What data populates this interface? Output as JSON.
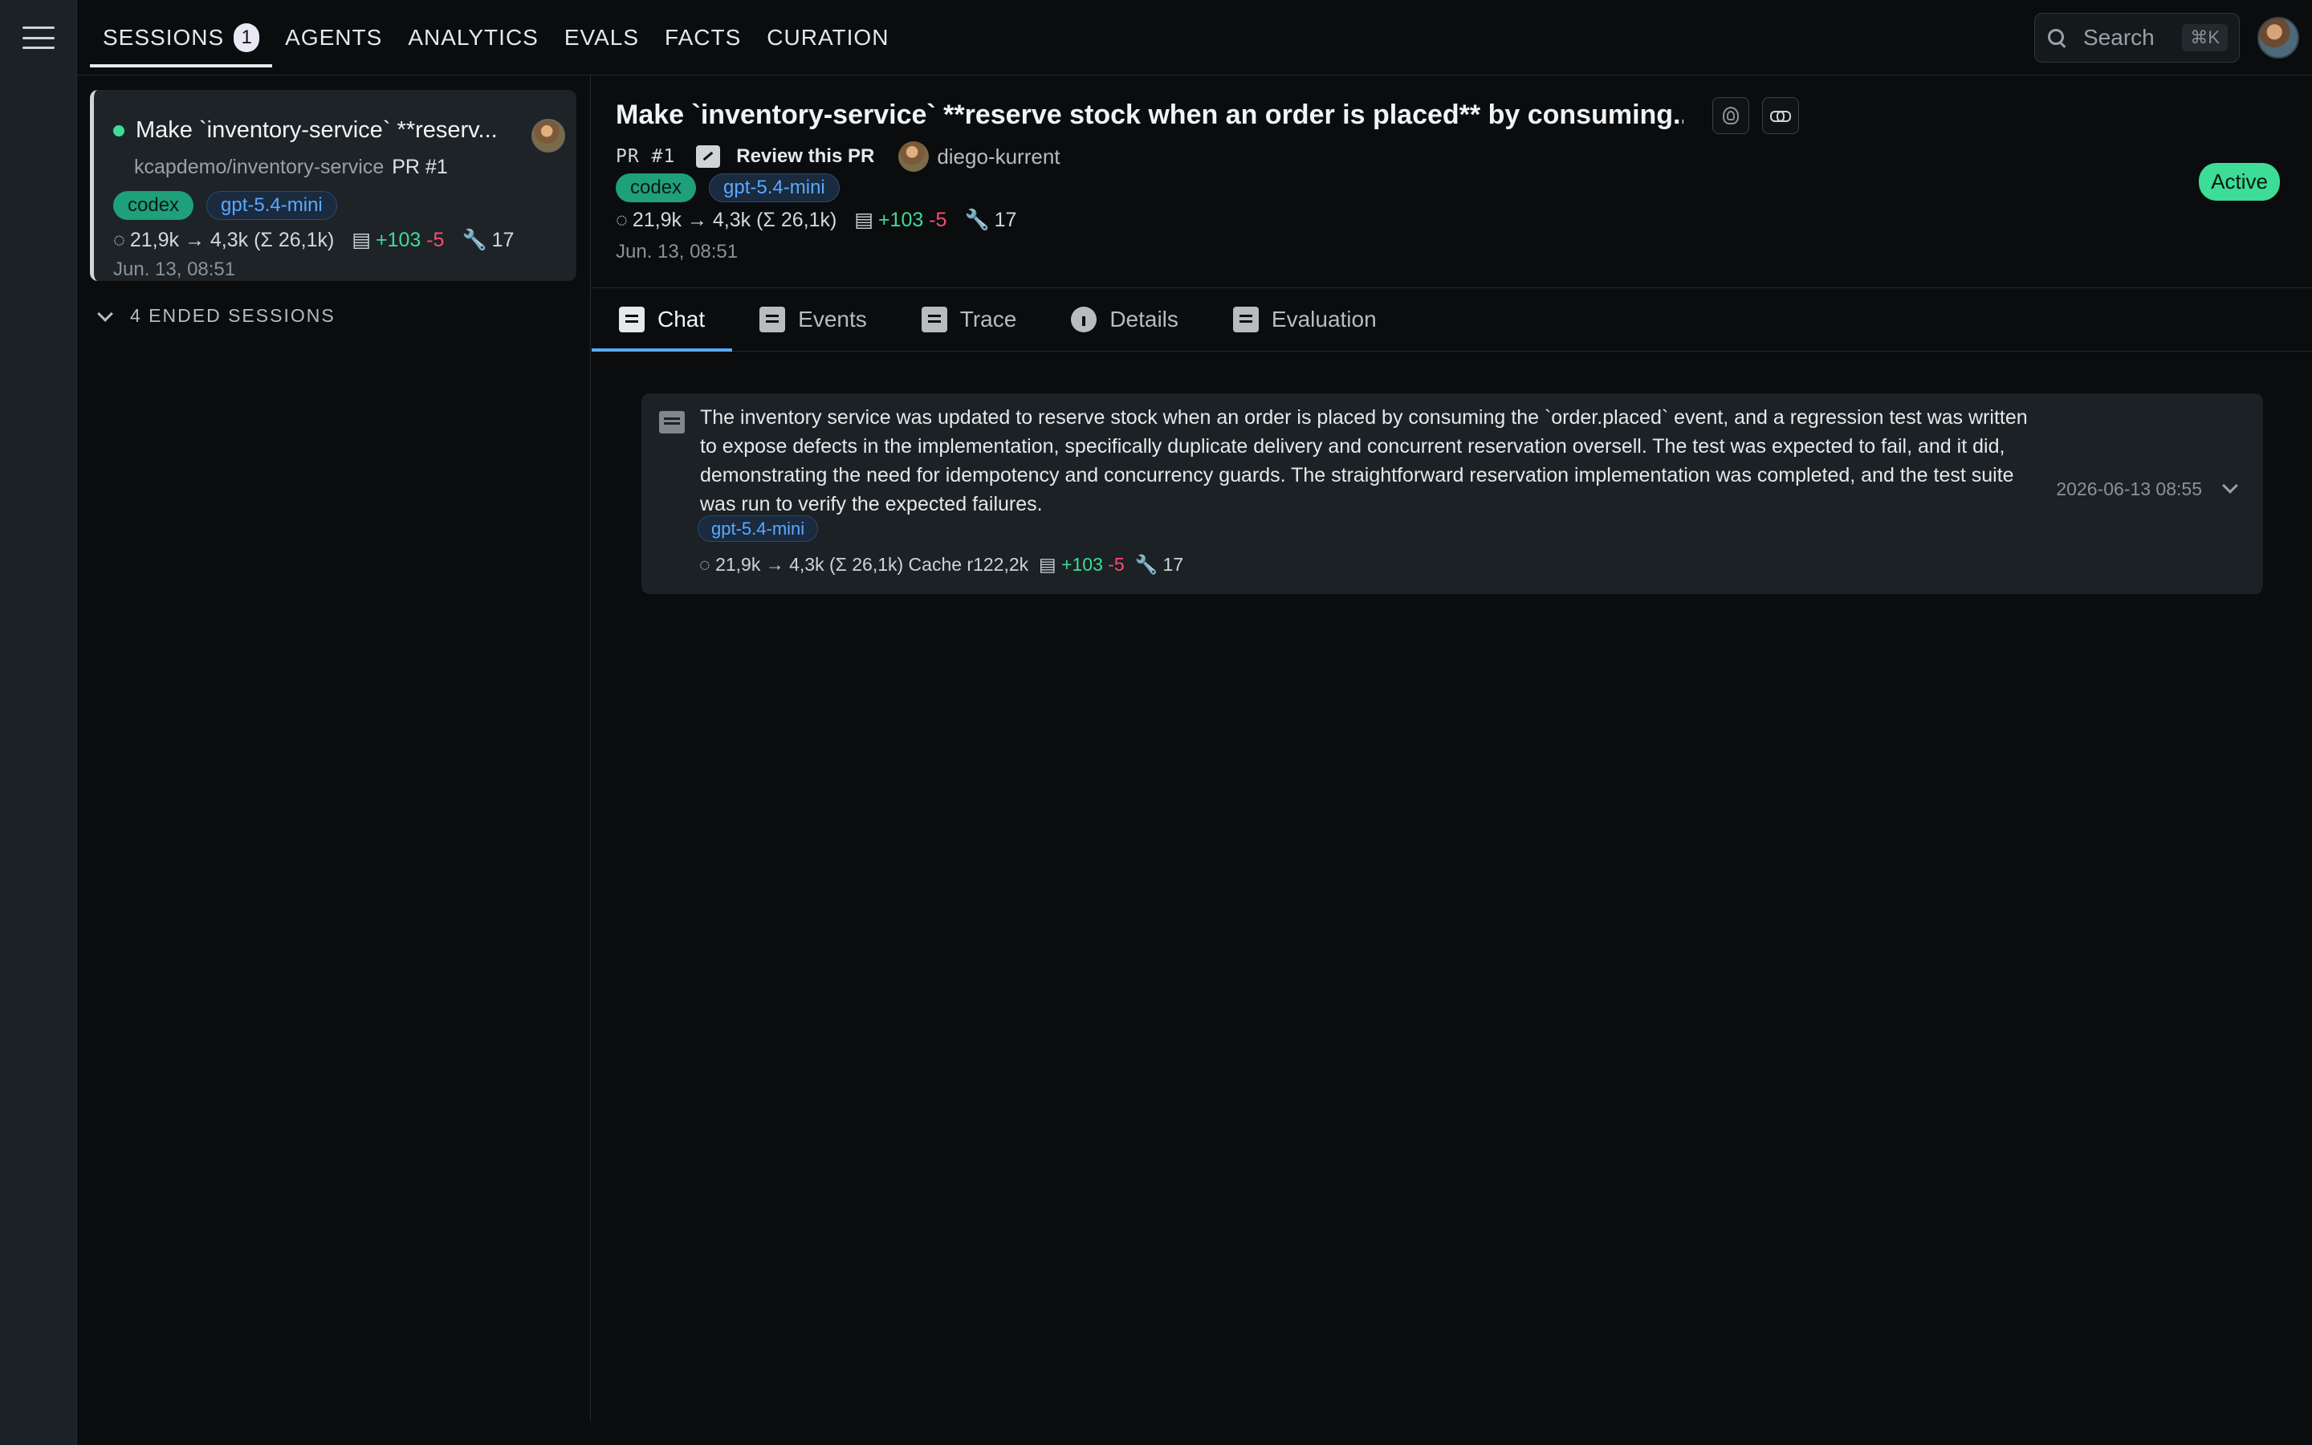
{
  "nav": {
    "items": [
      {
        "label": "SESSIONS",
        "badge": "1"
      },
      {
        "label": "AGENTS"
      },
      {
        "label": "ANALYTICS"
      },
      {
        "label": "EVALS"
      },
      {
        "label": "FACTS"
      },
      {
        "label": "CURATION"
      }
    ],
    "search_placeholder": "Search",
    "search_shortcut": "⌘K"
  },
  "sidebar": {
    "active_session": {
      "title": "Make `inventory-service` **reserv...",
      "repo": "kcapdemo/inventory-service",
      "pr": "PR #1",
      "agent_tag": "codex",
      "model_tag": "gpt-5.4-mini",
      "tokens": "21,9k → 4,3k (Σ 26,1k)",
      "additions": "+103",
      "deletions": "-5",
      "tools": "17",
      "time": "Jun. 13, 08:51"
    },
    "ended_label": "4 ENDED SESSIONS"
  },
  "main": {
    "title": "Make `inventory-service` **reserve stock when an order is placed** by consuming...",
    "pr": "PR #1",
    "review_label": "Review this PR",
    "author": "diego-kurrent",
    "agent_tag": "codex",
    "model_tag": "gpt-5.4-mini",
    "tokens": "21,9k → 4,3k (Σ 26,1k)",
    "additions": "+103",
    "deletions": "-5",
    "tools": "17",
    "time": "Jun. 13, 08:51",
    "status": "Active",
    "tabs": [
      "Chat",
      "Events",
      "Trace",
      "Details",
      "Evaluation"
    ]
  },
  "message": {
    "text": "The inventory service was updated to reserve stock when an order is placed by consuming the `order.placed` event, and a regression test was written to expose defects in the implementation, specifically duplicate delivery and concurrent reservation oversell. The test was expected to fail, and it did, demonstrating the need for idempotency and concurrency guards. The straightforward reservation implementation was completed, and the test suite was run to verify the expected failures.",
    "model_tag": "gpt-5.4-mini",
    "tokens": "21,9k → 4,3k (Σ 26,1k) Cache r122,2k",
    "additions": "+103",
    "deletions": "-5",
    "tools": "17",
    "date": "2026-06-13 08:55"
  },
  "colors": {
    "accent": "#5aa9ff",
    "active_green": "#3ddc97",
    "deletion_red": "#ff4d6d",
    "codex_green": "#1ea07a"
  }
}
